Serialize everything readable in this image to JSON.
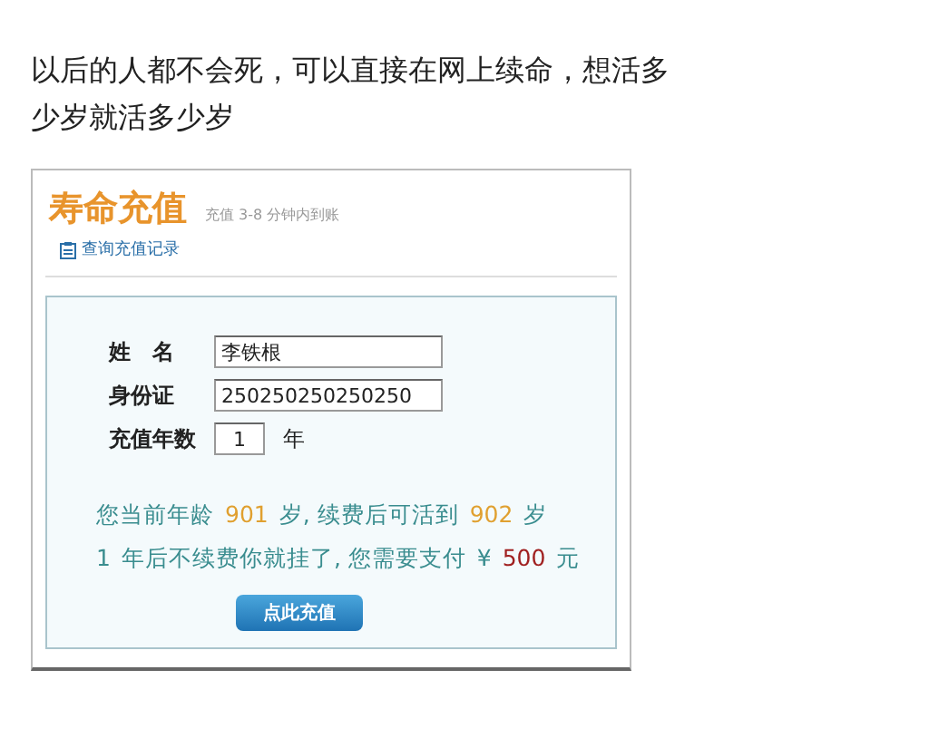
{
  "post": {
    "lines": [
      "以后的人都不会死，可以直接在网上续命，想活多",
      "少岁就活多少岁"
    ]
  },
  "card": {
    "title": "寿命充值",
    "subtitle": "充值 3-8 分钟内到账",
    "link": "查询充值记录",
    "fields": [
      {
        "label": "姓　名",
        "value": "李铁根",
        "kind": "wide"
      },
      {
        "label": "身份证",
        "value": "250250250250250",
        "kind": "wide"
      },
      {
        "label": "充值年数",
        "value": "1",
        "kind": "short",
        "suffix": "年"
      }
    ],
    "info": [
      [
        {
          "text": "您当前年龄",
          "kind": "plain"
        },
        {
          "text": "901",
          "kind": "age"
        },
        {
          "text": "岁, 续费后可活到",
          "kind": "plain"
        },
        {
          "text": "902",
          "kind": "age"
        },
        {
          "text": "岁",
          "kind": "plain"
        }
      ],
      [
        {
          "text": "1",
          "kind": "plain"
        },
        {
          "text": "年后不续费你就挂了, 您需要支付",
          "kind": "plain"
        },
        {
          "text": "¥",
          "kind": "plain"
        },
        {
          "text": "500",
          "kind": "price"
        },
        {
          "text": "元",
          "kind": "plain"
        }
      ]
    ],
    "button": "点此充值"
  }
}
